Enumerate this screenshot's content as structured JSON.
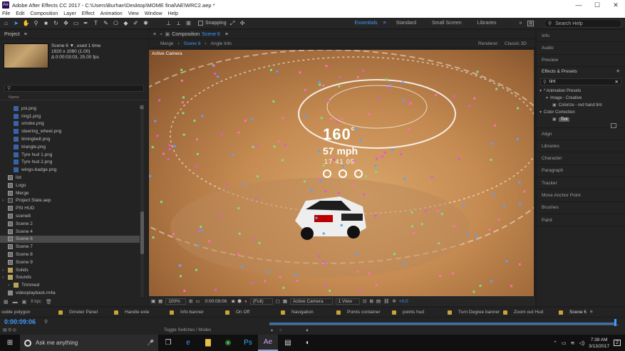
{
  "window": {
    "title": "Adobe After Effects CC 2017 - C:\\Users\\Burhan\\Desktop\\MOME final\\AE\\WRC2.aep *",
    "app_badge": "Ae",
    "minimize": "—",
    "maximize": "☐",
    "close": "✕"
  },
  "menu": [
    "File",
    "Edit",
    "Composition",
    "Layer",
    "Effect",
    "Animation",
    "View",
    "Window",
    "Help"
  ],
  "toolbar": {
    "snapping_label": "Snapping",
    "workspaces": [
      "Essentials",
      "Standard",
      "Small Screen",
      "Libraries"
    ],
    "search_placeholder": "Search Help"
  },
  "project": {
    "panel_title": "Project",
    "selected_name": "Scene 6",
    "used_text": ", used 1 time",
    "dimensions": "1920 x 1080 (1.00)",
    "duration": "Δ 0:00:03:03, 25.00 fps",
    "column_name": "Name",
    "bpc": "8 bpc",
    "items": [
      {
        "name": "psi.png",
        "type": "png",
        "indent": 2,
        "selected": false
      },
      {
        "name": "ring1.png",
        "type": "png",
        "indent": 2,
        "selected": false
      },
      {
        "name": "smoke.png",
        "type": "png",
        "indent": 2,
        "selected": false
      },
      {
        "name": "steering_wheel.png",
        "type": "png",
        "indent": 2,
        "selected": false
      },
      {
        "name": "timingbelt.png",
        "type": "png",
        "indent": 2,
        "selected": false
      },
      {
        "name": "triangle.png",
        "type": "png",
        "indent": 2,
        "selected": false
      },
      {
        "name": "Tyre hud 1.png",
        "type": "png",
        "indent": 2,
        "selected": false
      },
      {
        "name": "Tyre hud 2.png",
        "type": "png",
        "indent": 2,
        "selected": false
      },
      {
        "name": "wings-badge.png",
        "type": "png",
        "indent": 2,
        "selected": false
      },
      {
        "name": "list",
        "type": "comp",
        "indent": 1,
        "selected": false
      },
      {
        "name": "Logo",
        "type": "comp",
        "indent": 1,
        "selected": false
      },
      {
        "name": "Merge",
        "type": "comp",
        "indent": 1,
        "selected": false
      },
      {
        "name": "Project Slate.aep",
        "type": "aep",
        "indent": 0,
        "selected": false
      },
      {
        "name": "PSI HUD",
        "type": "comp",
        "indent": 1,
        "selected": false
      },
      {
        "name": "scene8",
        "type": "comp",
        "indent": 1,
        "selected": false
      },
      {
        "name": "Scene 2",
        "type": "comp",
        "indent": 1,
        "selected": false
      },
      {
        "name": "Scene 4",
        "type": "comp",
        "indent": 1,
        "selected": false
      },
      {
        "name": "Scene 6",
        "type": "comp",
        "indent": 1,
        "selected": true
      },
      {
        "name": "Scene 7",
        "type": "comp",
        "indent": 1,
        "selected": false
      },
      {
        "name": "Scene 8",
        "type": "comp",
        "indent": 1,
        "selected": false
      },
      {
        "name": "Scene 9",
        "type": "comp",
        "indent": 1,
        "selected": false
      },
      {
        "name": "Solids",
        "type": "folder",
        "indent": 0,
        "selected": false
      },
      {
        "name": "Sounds",
        "type": "folder",
        "indent": 0,
        "selected": false
      },
      {
        "name": "Trimmed",
        "type": "folder",
        "indent": 1,
        "selected": false
      },
      {
        "name": "videoplayback.m4a",
        "type": "vid",
        "indent": 1,
        "selected": false
      }
    ]
  },
  "composition": {
    "tab_label": "Composition",
    "tab_comp": "Scene 6",
    "crumbs": [
      "Merge",
      "Scene 6",
      "Angle Info"
    ],
    "renderer_label": "Renderer:",
    "renderer_value": "Classic 3D",
    "viewer_label": "Active Camera",
    "hud_speed": "160",
    "hud_speed_unit": "c",
    "hud_mph": "57 mph",
    "hud_time": "17 41 05",
    "footer": {
      "zoom": "100%",
      "timecode": "0:00:09:06",
      "resolution": "(Full)",
      "camera": "Active Camera",
      "views": "1 View",
      "exposure": "+0.0"
    }
  },
  "right_panel": {
    "items_top": [
      "Info",
      "Audio",
      "Preview"
    ],
    "effects_title": "Effects & Presets",
    "effects_search": "tint",
    "tree": [
      {
        "label": "* Animation Presets",
        "level": 0
      },
      {
        "label": "Image - Creative",
        "level": 1
      },
      {
        "label": "Colorize - red hand tint",
        "level": 2
      },
      {
        "label": "Color Correction",
        "level": 0
      },
      {
        "label": "Tint",
        "level": 2,
        "selected": true
      }
    ],
    "items_bottom": [
      "Align",
      "Libraries",
      "Character",
      "Paragraph",
      "Tracker",
      "Move Anchor Point",
      "Brushes",
      "Paint"
    ]
  },
  "timeline": {
    "tabs": [
      {
        "label": "ouble polygon",
        "color": "#9a9a9a"
      },
      {
        "label": "Gmeter Panel",
        "color": "#c9a43c"
      },
      {
        "label": "Handle exle",
        "color": "#c9a43c"
      },
      {
        "label": "Info banner",
        "color": "#c9a43c"
      },
      {
        "label": "On Off",
        "color": "#c9a43c"
      },
      {
        "label": "Navigation",
        "color": "#c9a43c"
      },
      {
        "label": "Points container",
        "color": "#c9a43c"
      },
      {
        "label": "points hud",
        "color": "#c9a43c"
      },
      {
        "label": "Turn Degree banner",
        "color": "#c9a43c"
      },
      {
        "label": "Zoom out Hud",
        "color": "#c9a43c"
      },
      {
        "label": "Scene 6",
        "color": "#c9a43c"
      }
    ],
    "timecode": "0:00:09:06",
    "toggle_label": "Toggle Switches / Modes"
  },
  "taskbar": {
    "cortana_placeholder": "Ask me anything",
    "time": "7:38 AM",
    "date": "3/13/2017",
    "notifications": "2",
    "apps": [
      {
        "name": "task-view",
        "glyph": "❐",
        "on": false
      },
      {
        "name": "edge",
        "glyph": "e",
        "on": false
      },
      {
        "name": "file-explorer",
        "glyph": "▇",
        "on": false
      },
      {
        "name": "chrome",
        "glyph": "◉",
        "on": false
      },
      {
        "name": "photoshop",
        "glyph": "Ps",
        "on": false
      },
      {
        "name": "after-effects",
        "glyph": "Ae",
        "on": true
      },
      {
        "name": "clapper",
        "glyph": "▤",
        "on": false
      },
      {
        "name": "steam",
        "glyph": "◐",
        "on": false
      }
    ]
  }
}
